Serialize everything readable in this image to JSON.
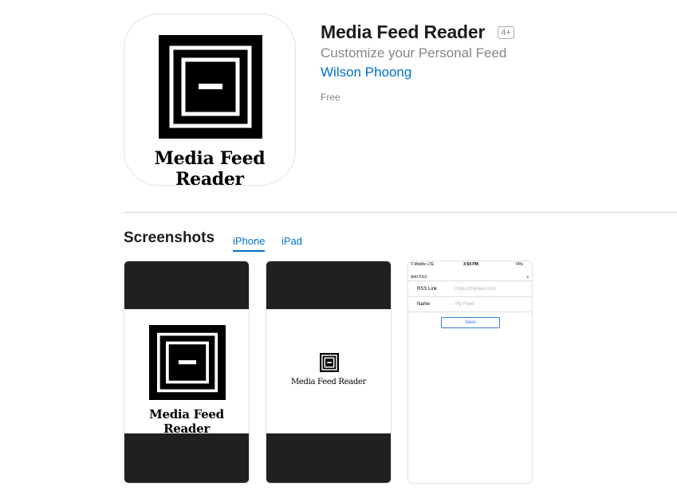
{
  "app": {
    "title": "Media Feed Reader",
    "age_rating": "4+",
    "subtitle": "Customize your Personal Feed",
    "developer": "Wilson Phoong",
    "price": "Free",
    "icon_wordmark": "Media Feed Reader"
  },
  "screenshots": {
    "section_title": "Screenshots",
    "tabs": [
      {
        "label": "iPhone",
        "selected": true
      },
      {
        "label": "iPad",
        "selected": false
      }
    ],
    "items": [
      {
        "kind": "splash-large",
        "wordmark": "Media Feed Reader"
      },
      {
        "kind": "splash-small",
        "wordmark": "Media Feed Reader"
      },
      {
        "kind": "add-rss-form",
        "status_carrier": "T-Mobile  LTE",
        "status_time": "3:54 PM",
        "status_battery": "74%",
        "header_title": "Add RSS",
        "header_close": "x",
        "fields": [
          {
            "label": "RSS Link",
            "placeholder": "https://myfeed.com"
          },
          {
            "label": "Name",
            "placeholder": "My Feed"
          }
        ],
        "save_label": "Save"
      }
    ]
  },
  "colors": {
    "link": "#0070c9",
    "secondary_text": "#86868b",
    "band": "#202020"
  }
}
